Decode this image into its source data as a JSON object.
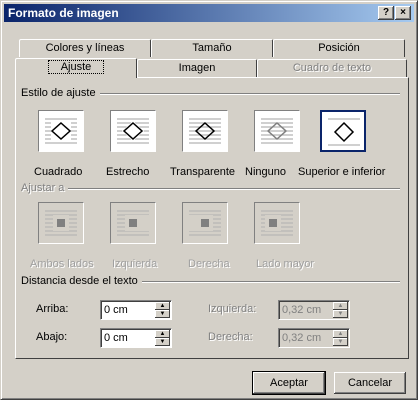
{
  "window": {
    "title": "Formato de imagen",
    "help_label": "?",
    "close_label": "×"
  },
  "tabs_back": [
    {
      "label": "Colores y líneas"
    },
    {
      "label": "Tamaño"
    },
    {
      "label": "Posición"
    }
  ],
  "tabs_front": [
    {
      "label": "Ajuste",
      "active": true
    },
    {
      "label": "Imagen"
    },
    {
      "label": "Cuadro de texto",
      "disabled": true
    }
  ],
  "wrap_style": {
    "label": "Estilo de ajuste",
    "options": [
      {
        "label": "Cuadrado",
        "icon": "wrap-square-icon"
      },
      {
        "label": "Estrecho",
        "icon": "wrap-tight-icon"
      },
      {
        "label": "Transparente",
        "icon": "wrap-through-icon"
      },
      {
        "label": "Ninguno",
        "icon": "wrap-none-icon"
      },
      {
        "label": "Superior e inferior",
        "icon": "wrap-top-bottom-icon",
        "selected": true
      }
    ]
  },
  "wrap_to": {
    "label": "Ajustar a",
    "options": [
      {
        "label": "Ambos lados",
        "icon": "both-sides-icon"
      },
      {
        "label": "Izquierda",
        "icon": "left-side-icon"
      },
      {
        "label": "Derecha",
        "icon": "right-side-icon"
      },
      {
        "label": "Lado mayor",
        "icon": "largest-side-icon"
      }
    ]
  },
  "distance": {
    "label": "Distancia desde el texto",
    "top": {
      "label": "Arriba:",
      "value": "0 cm"
    },
    "bottom": {
      "label": "Abajo:",
      "value": "0 cm"
    },
    "left": {
      "label": "Izquierda:",
      "value": "0,32 cm"
    },
    "right": {
      "label": "Derecha:",
      "value": "0,32 cm"
    }
  },
  "buttons": {
    "ok": "Aceptar",
    "cancel": "Cancelar"
  }
}
